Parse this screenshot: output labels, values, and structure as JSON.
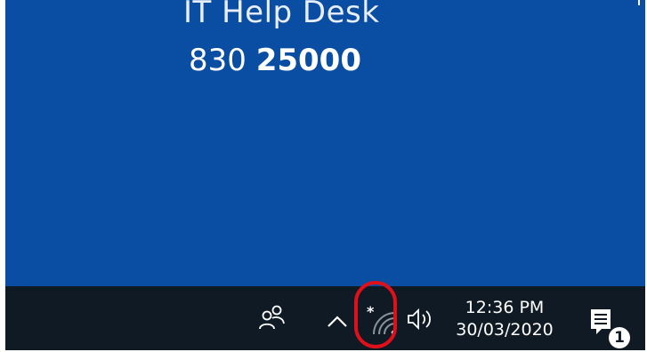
{
  "wallpaper": {
    "line1": "IT Help Desk",
    "line2_prefix": "830 ",
    "line2_bold": "25000"
  },
  "taskbar": {
    "clock": {
      "time": "12:36 PM",
      "date": "30/03/2020"
    },
    "notifications": {
      "count": "1"
    },
    "icons": {
      "people": "people-icon",
      "chevron": "chevron-up-icon",
      "wifi": "wifi-icon",
      "volume": "speaker-icon",
      "action_center": "action-center-icon"
    }
  },
  "colors": {
    "desktop": "#0a4ea3",
    "taskbar": "#0f1a25",
    "highlight": "#e0101a"
  }
}
